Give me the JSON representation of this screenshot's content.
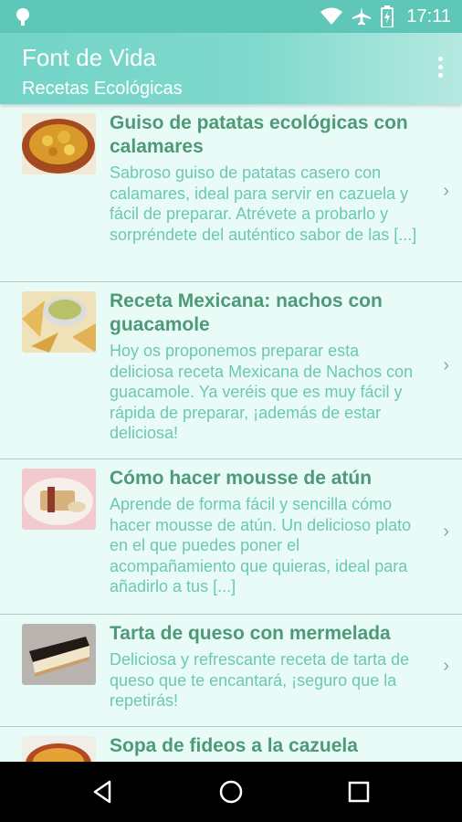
{
  "status_bar": {
    "time": "17:11",
    "icons": [
      "android-icon",
      "wifi-icon",
      "airplane-icon",
      "battery-charging-icon"
    ]
  },
  "app_bar": {
    "title": "Font de Vida",
    "subtitle": "Recetas Ecológicas",
    "menu_icon": "overflow-menu-icon"
  },
  "recipes": [
    {
      "title": "Guiso de patatas ecológicas con calamares",
      "description": "Sabroso guiso de patatas casero con calamares, ideal para servir en cazuela y fácil de preparar. Atrévete a probarlo y sorpréndete del auténtico sabor de las [...]",
      "thumb_icon": "potato-stew-image"
    },
    {
      "title": "Receta Mexicana: nachos con guacamole",
      "description": "Hoy os proponemos preparar esta deliciosa receta Mexicana de Nachos con guacamole. Ya veréis que es muy fácil y rápida de preparar, ¡además de estar deliciosa!",
      "thumb_icon": "nachos-image"
    },
    {
      "title": "Cómo hacer mousse de atún",
      "description": "Aprende de forma fácil y sencilla cómo hacer mousse de atún. Un delicioso plato en el que puedes poner el acompañamiento que quieras, ideal para añadirlo a tus [...]",
      "thumb_icon": "tuna-mousse-image"
    },
    {
      "title": "Tarta de queso con mermelada",
      "description": "Deliciosa y refrescante receta de tarta de queso que te encantará, ¡seguro que la repetirás!",
      "thumb_icon": "cheesecake-image"
    },
    {
      "title": "Sopa de fideos a la cazuela",
      "description": "",
      "thumb_icon": "noodle-soup-image"
    }
  ],
  "nav_bar": {
    "icons": [
      "back-icon",
      "home-icon",
      "recents-icon"
    ]
  },
  "colors": {
    "status_bar": "#5fc7b8",
    "app_bar": "#72d4c7",
    "title_text": "#4d9a78",
    "desc_text": "#6cc7b6",
    "background": "#e9fbf6"
  }
}
